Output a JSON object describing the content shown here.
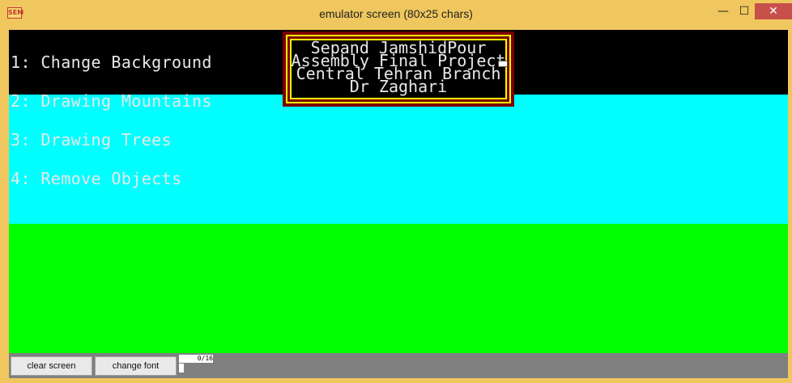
{
  "window": {
    "title": "emulator screen (80x25 chars)",
    "app_icon_text": "SEM",
    "minimize_glyph": "—",
    "maximize_glyph": "☐",
    "close_glyph": "✕"
  },
  "screen": {
    "menu": [
      "1: Change Background",
      "2: Drawing Mountains",
      "3: Drawing Trees",
      "4: Remove Objects"
    ],
    "credits": [
      "Sepand JamshidPour",
      "Assembly Final Project",
      "Central Tehran Branch",
      "Dr Zaghari"
    ],
    "colors": {
      "background": "#000000",
      "sky": "#00ffff",
      "ground": "#00ff00",
      "credits_frame": "#7a0000",
      "credits_border": "#ffff00"
    }
  },
  "bottom_bar": {
    "clear_label": "clear screen",
    "font_label": "change font",
    "page_indicator": "0/16"
  }
}
